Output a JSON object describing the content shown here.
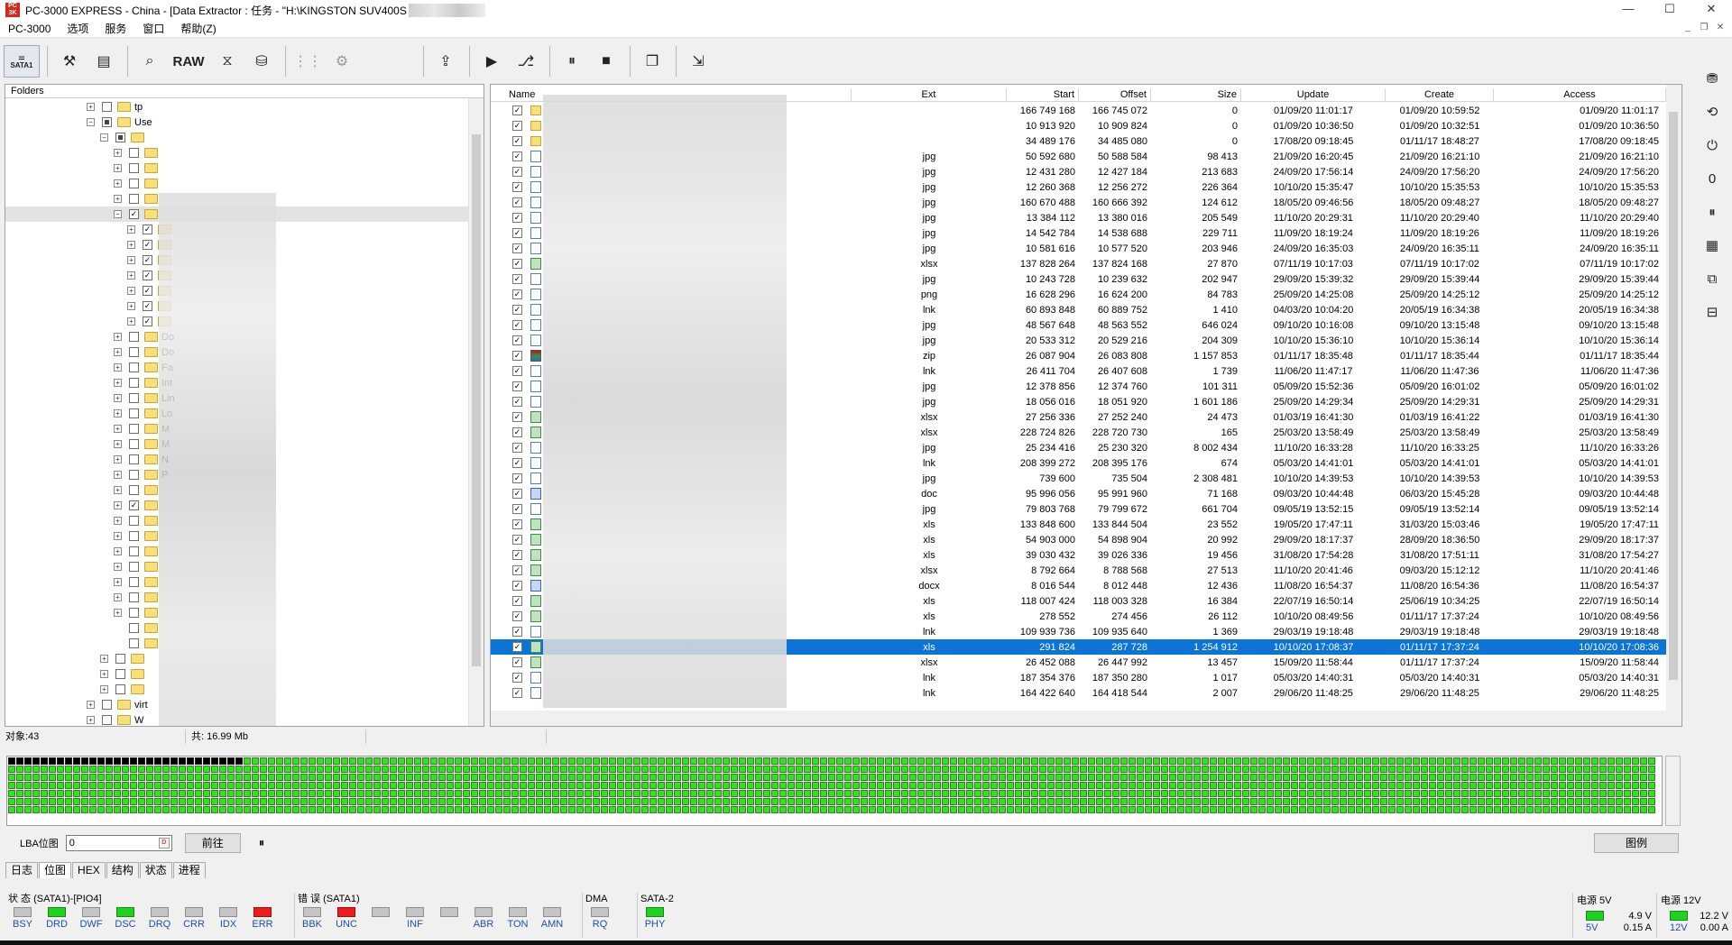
{
  "window": {
    "title": "PC-3000 EXPRESS - China - [Data Extractor : 任务 - \"H:\\KINGSTON SUV400S",
    "controls": [
      "—",
      "☐",
      "✕"
    ]
  },
  "menu": [
    "PC-3000",
    "选项",
    "服务",
    "窗口",
    "帮助(Z)"
  ],
  "toolbar": {
    "sata_label": "SATA1",
    "raw_label": "RAW"
  },
  "folders": {
    "header": "Folders",
    "rows": [
      {
        "label": "tp",
        "expander": "+",
        "check": "",
        "indent": 0
      },
      {
        "label": "Use",
        "expander": "−",
        "check": "partial",
        "indent": 0
      },
      {
        "label": "",
        "expander": "−",
        "check": "partial",
        "indent": 1
      },
      {
        "label": "",
        "expander": "+",
        "check": "",
        "indent": 2
      },
      {
        "label": "",
        "expander": "+",
        "check": "",
        "indent": 2
      },
      {
        "label": "",
        "expander": "+",
        "check": "",
        "indent": 2
      },
      {
        "label": "",
        "expander": "+",
        "check": "",
        "indent": 2
      },
      {
        "label": "",
        "expander": "−",
        "check": "✓",
        "indent": 2,
        "highlight": true
      },
      {
        "label": "",
        "expander": "+",
        "check": "✓",
        "indent": 3
      },
      {
        "label": "",
        "expander": "+",
        "check": "✓",
        "indent": 3
      },
      {
        "label": "",
        "expander": "+",
        "check": "✓",
        "indent": 3
      },
      {
        "label": "",
        "expander": "+",
        "check": "✓",
        "indent": 3
      },
      {
        "label": "",
        "expander": "+",
        "check": "✓",
        "indent": 3
      },
      {
        "label": "",
        "expander": "+",
        "check": "✓",
        "indent": 3
      },
      {
        "label": "",
        "expander": "+",
        "check": "✓",
        "indent": 3
      },
      {
        "label": "Do",
        "expander": "+",
        "check": "",
        "indent": 2
      },
      {
        "label": "Do",
        "expander": "+",
        "check": "",
        "indent": 2
      },
      {
        "label": "Fa",
        "expander": "+",
        "check": "",
        "indent": 2
      },
      {
        "label": "Int",
        "expander": "+",
        "check": "",
        "indent": 2
      },
      {
        "label": "Lin",
        "expander": "+",
        "check": "",
        "indent": 2
      },
      {
        "label": "Lo",
        "expander": "+",
        "check": "",
        "indent": 2
      },
      {
        "label": "M",
        "expander": "+",
        "check": "",
        "indent": 2
      },
      {
        "label": "M",
        "expander": "+",
        "check": "",
        "indent": 2
      },
      {
        "label": "N",
        "expander": "+",
        "check": "",
        "indent": 2
      },
      {
        "label": "P",
        "expander": "+",
        "check": "",
        "indent": 2
      },
      {
        "label": "",
        "expander": "+",
        "check": "",
        "indent": 2
      },
      {
        "label": "",
        "expander": "+",
        "check": "✓",
        "indent": 2
      },
      {
        "label": "",
        "expander": "+",
        "check": "",
        "indent": 2
      },
      {
        "label": "",
        "expander": "+",
        "check": "",
        "indent": 2
      },
      {
        "label": "",
        "expander": "+",
        "check": "",
        "indent": 2
      },
      {
        "label": "",
        "expander": "+",
        "check": "",
        "indent": 2
      },
      {
        "label": "",
        "expander": "+",
        "check": "",
        "indent": 2
      },
      {
        "label": "",
        "expander": "+",
        "check": "",
        "indent": 2
      },
      {
        "label": "",
        "expander": "+",
        "check": "",
        "indent": 2
      },
      {
        "label": "",
        "expander": "",
        "check": "",
        "indent": 2
      },
      {
        "label": "",
        "expander": "",
        "check": "",
        "indent": 2
      },
      {
        "label": "",
        "expander": "+",
        "check": "",
        "indent": 1
      },
      {
        "label": "",
        "expander": "+",
        "check": "",
        "indent": 1
      },
      {
        "label": "",
        "expander": "+",
        "check": "",
        "indent": 1
      },
      {
        "label": "virt",
        "expander": "+",
        "check": "",
        "indent": 0
      },
      {
        "label": "W",
        "expander": "+",
        "check": "",
        "indent": 0
      },
      {
        "label": "",
        "expander": "+",
        "check": "",
        "indent": 0
      }
    ]
  },
  "files": {
    "columns": [
      "Name",
      "Ext",
      "Start",
      "Offset",
      "Size",
      "Update",
      "Create",
      "Access"
    ],
    "rows": [
      {
        "icon": "folder",
        "ext": "",
        "start": "166 749 168",
        "offset": "166 745 072",
        "size": "0",
        "update": "01/09/20 11:01:17",
        "create": "01/09/20 10:59:52",
        "access": "01/09/20 11:01:17"
      },
      {
        "icon": "folder",
        "ext": "",
        "start": "10 913 920",
        "offset": "10 909 824",
        "size": "0",
        "update": "01/09/20 10:36:50",
        "create": "01/09/20 10:32:51",
        "access": "01/09/20 10:36:50"
      },
      {
        "icon": "folder",
        "ext": "",
        "start": "34 489 176",
        "offset": "34 485 080",
        "size": "0",
        "update": "17/08/20 09:18:45",
        "create": "01/11/17 18:48:27",
        "access": "17/08/20 09:18:45"
      },
      {
        "icon": "file",
        "ext": "jpg",
        "start": "50 592 680",
        "offset": "50 588 584",
        "size": "98 413",
        "update": "21/09/20 16:20:45",
        "create": "21/09/20 16:21:10",
        "access": "21/09/20 16:21:10"
      },
      {
        "icon": "file",
        "ext": "jpg",
        "start": "12 431 280",
        "offset": "12 427 184",
        "size": "213 683",
        "update": "24/09/20 17:56:14",
        "create": "24/09/20 17:56:20",
        "access": "24/09/20 17:56:20"
      },
      {
        "icon": "file",
        "ext": "jpg",
        "start": "12 260 368",
        "offset": "12 256 272",
        "size": "226 364",
        "update": "10/10/20 15:35:47",
        "create": "10/10/20 15:35:53",
        "access": "10/10/20 15:35:53"
      },
      {
        "icon": "file",
        "ext": "jpg",
        "start": "160 670 488",
        "offset": "160 666 392",
        "size": "124 612",
        "update": "18/05/20 09:46:56",
        "create": "18/05/20 09:48:27",
        "access": "18/05/20 09:48:27"
      },
      {
        "icon": "file",
        "ext": "jpg",
        "start": "13 384 112",
        "offset": "13 380 016",
        "size": "205 549",
        "update": "11/10/20 20:29:31",
        "create": "11/10/20 20:29:40",
        "access": "11/10/20 20:29:40"
      },
      {
        "icon": "file",
        "ext": "jpg",
        "start": "14 542 784",
        "offset": "14 538 688",
        "size": "229 711",
        "update": "11/09/20 18:19:24",
        "create": "11/09/20 18:19:26",
        "access": "11/09/20 18:19:26"
      },
      {
        "icon": "file",
        "ext": "jpg",
        "start": "10 581 616",
        "offset": "10 577 520",
        "size": "203 946",
        "update": "24/09/20 16:35:03",
        "create": "24/09/20 16:35:11",
        "access": "24/09/20 16:35:11"
      },
      {
        "icon": "xls",
        "ext": "xlsx",
        "start": "137 828 264",
        "offset": "137 824 168",
        "size": "27 870",
        "update": "07/11/19 10:17:03",
        "create": "07/11/19 10:17:02",
        "access": "07/11/19 10:17:02"
      },
      {
        "icon": "file",
        "ext": "jpg",
        "start": "10 243 728",
        "offset": "10 239 632",
        "size": "202 947",
        "update": "29/09/20 15:39:32",
        "create": "29/09/20 15:39:44",
        "access": "29/09/20 15:39:44"
      },
      {
        "icon": "file",
        "ext": "png",
        "start": "16 628 296",
        "offset": "16 624 200",
        "size": "84 783",
        "update": "25/09/20 14:25:08",
        "create": "25/09/20 14:25:12",
        "access": "25/09/20 14:25:12"
      },
      {
        "icon": "file",
        "ext": "lnk",
        "start": "60 893 848",
        "offset": "60 889 752",
        "size": "1 410",
        "update": "04/03/20 10:04:20",
        "create": "20/05/19 16:34:38",
        "access": "20/05/19 16:34:38"
      },
      {
        "icon": "file",
        "ext": "jpg",
        "start": "48 567 648",
        "offset": "48 563 552",
        "size": "646 024",
        "update": "09/10/20 10:16:08",
        "create": "09/10/20 13:15:48",
        "access": "09/10/20 13:15:48"
      },
      {
        "icon": "file",
        "ext": "jpg",
        "start": "20 533 312",
        "offset": "20 529 216",
        "size": "204 309",
        "update": "10/10/20 15:36:10",
        "create": "10/10/20 15:36:14",
        "access": "10/10/20 15:36:14"
      },
      {
        "icon": "zip",
        "ext": "zip",
        "start": "26 087 904",
        "offset": "26 083 808",
        "size": "1 157 853",
        "update": "01/11/17 18:35:48",
        "create": "01/11/17 18:35:44",
        "access": "01/11/17 18:35:44"
      },
      {
        "icon": "file",
        "ext": "lnk",
        "start": "26 411 704",
        "offset": "26 407 608",
        "size": "1 739",
        "update": "11/06/20 11:47:17",
        "create": "11/06/20 11:47:36",
        "access": "11/06/20 11:47:36"
      },
      {
        "icon": "file",
        "ext": "jpg",
        "start": "12 378 856",
        "offset": "12 374 760",
        "size": "101 311",
        "update": "05/09/20 15:52:36",
        "create": "05/09/20 16:01:02",
        "access": "05/09/20 16:01:02"
      },
      {
        "icon": "file",
        "ext": "jpg",
        "start": "18 056 016",
        "offset": "18 051 920",
        "size": "1 601 186",
        "update": "25/09/20 14:29:34",
        "create": "25/09/20 14:29:31",
        "access": "25/09/20 14:29:31"
      },
      {
        "icon": "xls",
        "ext": "xlsx",
        "start": "27 256 336",
        "offset": "27 252 240",
        "size": "24 473",
        "update": "01/03/19 16:41:30",
        "create": "01/03/19 16:41:22",
        "access": "01/03/19 16:41:30"
      },
      {
        "icon": "xls",
        "ext": "xlsx",
        "start": "228 724 826",
        "offset": "228 720 730",
        "size": "165",
        "update": "25/03/20 13:58:49",
        "create": "25/03/20 13:58:49",
        "access": "25/03/20 13:58:49"
      },
      {
        "icon": "file",
        "ext": "jpg",
        "start": "25 234 416",
        "offset": "25 230 320",
        "size": "8 002 434",
        "update": "11/10/20 16:33:28",
        "create": "11/10/20 16:33:25",
        "access": "11/10/20 16:33:26"
      },
      {
        "icon": "file",
        "ext": "lnk",
        "start": "208 399 272",
        "offset": "208 395 176",
        "size": "674",
        "update": "05/03/20 14:41:01",
        "create": "05/03/20 14:41:01",
        "access": "05/03/20 14:41:01"
      },
      {
        "icon": "file",
        "ext": "jpg",
        "start": "739 600",
        "offset": "735 504",
        "size": "2 308 481",
        "update": "10/10/20 14:39:53",
        "create": "10/10/20 14:39:53",
        "access": "10/10/20 14:39:53"
      },
      {
        "icon": "doc",
        "ext": "doc",
        "start": "95 996 056",
        "offset": "95 991 960",
        "size": "71 168",
        "update": "09/03/20 10:44:48",
        "create": "06/03/20 15:45:28",
        "access": "09/03/20 10:44:48"
      },
      {
        "icon": "file",
        "ext": "jpg",
        "start": "79 803 768",
        "offset": "79 799 672",
        "size": "661 704",
        "update": "09/05/19 13:52:15",
        "create": "09/05/19 13:52:14",
        "access": "09/05/19 13:52:14"
      },
      {
        "icon": "xls",
        "ext": "xls",
        "start": "133 848 600",
        "offset": "133 844 504",
        "size": "23 552",
        "update": "19/05/20 17:47:11",
        "create": "31/03/20 15:03:46",
        "access": "19/05/20 17:47:11"
      },
      {
        "icon": "xls",
        "ext": "xls",
        "start": "54 903 000",
        "offset": "54 898 904",
        "size": "20 992",
        "update": "29/09/20 18:17:37",
        "create": "28/09/20 18:36:50",
        "access": "29/09/20 18:17:37"
      },
      {
        "icon": "xls",
        "ext": "xls",
        "start": "39 030 432",
        "offset": "39 026 336",
        "size": "19 456",
        "update": "31/08/20 17:54:28",
        "create": "31/08/20 17:51:11",
        "access": "31/08/20 17:54:27"
      },
      {
        "icon": "xls",
        "ext": "xlsx",
        "start": "8 792 664",
        "offset": "8 788 568",
        "size": "27 513",
        "update": "11/10/20 20:41:46",
        "create": "09/03/20 15:12:12",
        "access": "11/10/20 20:41:46"
      },
      {
        "icon": "doc",
        "ext": "docx",
        "start": "8 016 544",
        "offset": "8 012 448",
        "size": "12 436",
        "update": "11/08/20 16:54:37",
        "create": "11/08/20 16:54:36",
        "access": "11/08/20 16:54:37"
      },
      {
        "icon": "xls",
        "ext": "xls",
        "start": "118 007 424",
        "offset": "118 003 328",
        "size": "16 384",
        "update": "22/07/19 16:50:14",
        "create": "25/06/19 10:34:25",
        "access": "22/07/19 16:50:14"
      },
      {
        "icon": "xls",
        "ext": "xls",
        "start": "278 552",
        "offset": "274 456",
        "size": "26 112",
        "update": "10/10/20 08:49:56",
        "create": "01/11/17 17:37:24",
        "access": "10/10/20 08:49:56"
      },
      {
        "icon": "file",
        "ext": "lnk",
        "start": "109 939 736",
        "offset": "109 935 640",
        "size": "1 369",
        "update": "29/03/19 19:18:48",
        "create": "29/03/19 19:18:48",
        "access": "29/03/19 19:18:48"
      },
      {
        "icon": "xls",
        "ext": "xls",
        "start": "291 824",
        "offset": "287 728",
        "size": "1 254 912",
        "update": "10/10/20 17:08:37",
        "create": "01/11/17 17:37:24",
        "access": "10/10/20 17:08:36",
        "selected": true
      },
      {
        "icon": "xls",
        "ext": "xlsx",
        "start": "26 452 088",
        "offset": "26 447 992",
        "size": "13 457",
        "update": "15/09/20 11:58:44",
        "create": "01/11/17 17:37:24",
        "access": "15/09/20 11:58:44"
      },
      {
        "icon": "file",
        "ext": "lnk",
        "start": "187 354 376",
        "offset": "187 350 280",
        "size": "1 017",
        "update": "05/03/20 14:40:31",
        "create": "05/03/20 14:40:31",
        "access": "05/03/20 14:40:31"
      },
      {
        "icon": "file",
        "ext": "lnk",
        "start": "164 422 640",
        "offset": "164 418 544",
        "size": "2 007",
        "update": "29/06/20 11:48:25",
        "create": "29/06/20 11:48:25",
        "access": "29/06/20 11:48:25"
      }
    ]
  },
  "statusbar": {
    "objects": "对象:43",
    "total": "共: 16.99 Mb"
  },
  "lba_map": {
    "progress_fraction": 0.143,
    "label": "LBA位图",
    "input_value": "0",
    "go_button": "前往",
    "pause_glyph": "⏸",
    "legend_button": "图例"
  },
  "tabs": [
    "日志",
    "位图",
    "HEX",
    "结构",
    "状态",
    "进程"
  ],
  "active_tab": 1,
  "signals": {
    "status_header": "状 态 (SATA1)-[PIO4]",
    "status_leds": [
      {
        "name": "BSY",
        "state": "off"
      },
      {
        "name": "DRD",
        "state": "on"
      },
      {
        "name": "DWF",
        "state": "off"
      },
      {
        "name": "DSC",
        "state": "on"
      },
      {
        "name": "DRQ",
        "state": "off"
      },
      {
        "name": "CRR",
        "state": "off"
      },
      {
        "name": "IDX",
        "state": "off"
      },
      {
        "name": "ERR",
        "state": "err"
      }
    ],
    "error_header": "错 误 (SATA1)",
    "error_leds": [
      {
        "name": "BBK",
        "state": "off"
      },
      {
        "name": "UNC",
        "state": "err"
      },
      {
        "name": "",
        "state": "off"
      },
      {
        "name": "INF",
        "state": "off"
      },
      {
        "name": "",
        "state": "off"
      },
      {
        "name": "ABR",
        "state": "off"
      },
      {
        "name": "TON",
        "state": "off"
      },
      {
        "name": "AMN",
        "state": "off"
      }
    ],
    "dma_header": "DMA",
    "dma_leds": [
      {
        "name": "RQ",
        "state": "off"
      }
    ],
    "sata_header": "SATA-2",
    "sata_leds": [
      {
        "name": "PHY",
        "state": "on"
      }
    ]
  },
  "power": {
    "p5_header": "电源 5V",
    "p5_lamp": "5V",
    "p5_voltage": "4.9 V",
    "p5_current": "0.15 A",
    "p12_header": "电源 12V",
    "p12_lamp": "12V",
    "p12_voltage": "12.2 V",
    "p12_current": "0.00 A"
  }
}
